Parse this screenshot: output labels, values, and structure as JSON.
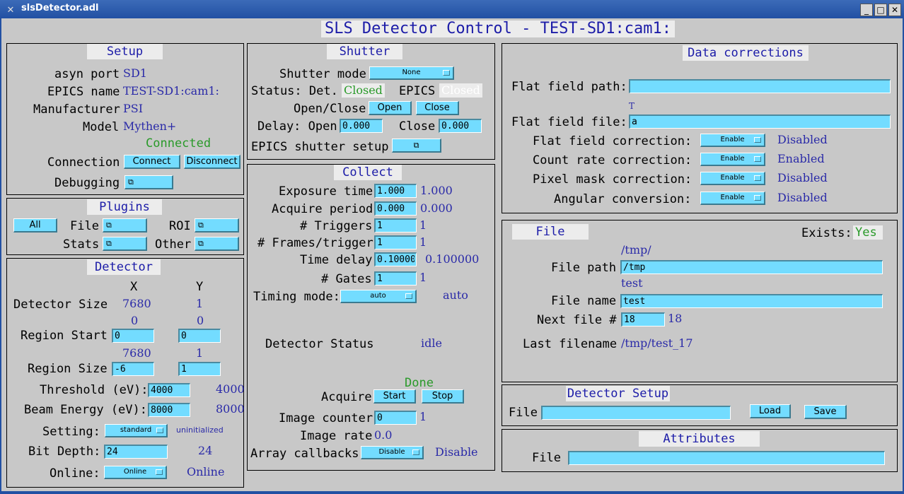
{
  "window": {
    "title": "slsDetector.adl"
  },
  "main_title": "SLS Detector Control - TEST-SD1:cam1:",
  "setup": {
    "title": "Setup",
    "asyn_port_label": "asyn port",
    "asyn_port": "SD1",
    "epics_name_label": "EPICS name",
    "epics_name": "TEST-SD1:cam1:",
    "manufacturer_label": "Manufacturer",
    "manufacturer": "PSI",
    "model_label": "Model",
    "model": "Mythen+",
    "connection_status": "Connected",
    "connection_label": "Connection",
    "connect": "Connect",
    "disconnect": "Disconnect",
    "debugging_label": "Debugging"
  },
  "plugins": {
    "title": "Plugins",
    "all": "All",
    "file_label": "File",
    "roi_label": "ROI",
    "stats_label": "Stats",
    "other_label": "Other"
  },
  "detector": {
    "title": "Detector",
    "x_header": "X",
    "y_header": "Y",
    "size_label": "Detector Size",
    "size_x": "7680",
    "size_y": "1",
    "start_rb_x": "0",
    "start_rb_y": "0",
    "region_start_label": "Region Start",
    "start_x": "0",
    "start_y": "0",
    "size_rb_x": "7680",
    "size_rb_y": "1",
    "region_size_label": "Region Size",
    "rsize_x": "-6",
    "rsize_y": "1",
    "threshold_label": "Threshold (eV):",
    "threshold": "4000",
    "threshold_rb": "4000",
    "beam_label": "Beam Energy (eV):",
    "beam": "8000",
    "beam_rb": "8000",
    "setting_label": "Setting:",
    "setting": "standard",
    "setting_rb": "uninitialized",
    "bitdepth_label": "Bit Depth:",
    "bitdepth": "24",
    "bitdepth_rb": "24",
    "online_label": "Online:",
    "online": "Online",
    "online_rb": "Online"
  },
  "shutter": {
    "title": "Shutter",
    "mode_label": "Shutter mode",
    "mode": "None",
    "status_label": "Status: Det.",
    "det_status": "Closed",
    "epics_label": "EPICS",
    "epics_status": "Closed",
    "openclose_label": "Open/Close",
    "open": "Open",
    "close": "Close",
    "delay_label": "Delay: Open",
    "delay_open": "0.000",
    "close_label": "Close",
    "delay_close": "0.000",
    "setup_label": "EPICS shutter setup"
  },
  "collect": {
    "title": "Collect",
    "exposure_label": "Exposure time",
    "exposure": "1.000",
    "exposure_rb": "1.000",
    "period_label": "Acquire period",
    "period": "0.000",
    "period_rb": "0.000",
    "triggers_label": "# Triggers",
    "triggers": "1",
    "triggers_rb": "1",
    "frames_label": "# Frames/trigger",
    "frames": "1",
    "frames_rb": "1",
    "tdelay_label": "Time delay",
    "tdelay": "0.100000",
    "tdelay_rb": "0.100000",
    "gates_label": "# Gates",
    "gates": "1",
    "gates_rb": "1",
    "timing_label": "Timing mode:",
    "timing": "auto",
    "timing_rb": "auto",
    "status_label": "Detector Status",
    "status": "idle",
    "acq_status": "Done",
    "acquire_label": "Acquire",
    "start": "Start",
    "stop": "Stop",
    "counter_label": "Image counter",
    "counter": "0",
    "counter_rb": "1",
    "rate_label": "Image rate",
    "rate": "0.0",
    "callbacks_label": "Array callbacks",
    "callbacks": "Disable",
    "callbacks_rb": "Disable"
  },
  "corrections": {
    "title": "Data corrections",
    "ff_path_label": "Flat field path:",
    "ff_path": "",
    "ff_file_rb": "T",
    "ff_file_label": "Flat field file:",
    "ff_file": "a",
    "ffc_label": "Flat field correction:",
    "ffc": "Enable",
    "ffc_rb": "Disabled",
    "crc_label": "Count rate correction:",
    "crc": "Enable",
    "crc_rb": "Enabled",
    "pmc_label": "Pixel mask correction:",
    "pmc": "Enable",
    "pmc_rb": "Disabled",
    "ac_label": "Angular conversion:",
    "ac": "Enable",
    "ac_rb": "Disabled"
  },
  "file": {
    "title": "File",
    "exists_label": "Exists:",
    "exists": "Yes",
    "path_rb": "/tmp/",
    "path_label": "File path",
    "path": "/tmp",
    "name_rb": "test",
    "name_label": "File name",
    "name": "test",
    "next_label": "Next file #",
    "next": "18",
    "next_rb": "18",
    "last_label": "Last filename",
    "last": "/tmp/test_17"
  },
  "detector_setup": {
    "title": "Detector Setup",
    "file_label": "File",
    "file": "",
    "load": "Load",
    "save": "Save"
  },
  "attributes": {
    "title": "Attributes",
    "file_label": "File",
    "file": ""
  },
  "colors": {
    "panel_bg": "#c8c8c8",
    "control": "#73dcff",
    "readback": "#2a2aa8",
    "ok_green": "#2a9a2a"
  },
  "icons": {
    "related_display": "related-display-icon",
    "menu_arrow": "menu-arrow-icon"
  }
}
